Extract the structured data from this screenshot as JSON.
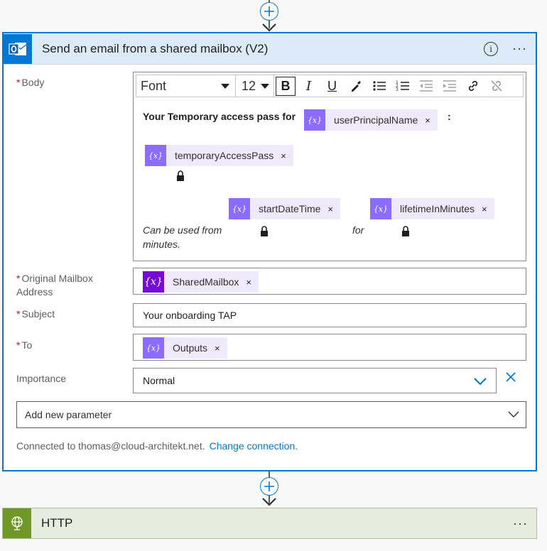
{
  "colors": {
    "accent": "#0078d4",
    "token": "#8c6cff",
    "http": "#709727"
  },
  "card": {
    "title": "Send an email from a shared mailbox (V2)",
    "info_icon": "info-icon",
    "more_label": "···"
  },
  "fields": {
    "body_label": "Body",
    "mailbox_label_1": "Original Mailbox",
    "mailbox_label_2": "Address",
    "subject_label": "Subject",
    "to_label": "To",
    "importance_label": "Importance",
    "required_mark": "*"
  },
  "toolbar": {
    "font": "Font",
    "size": "12",
    "bold": "B",
    "italic": "I",
    "underline": "U"
  },
  "body": {
    "intro": "Your Temporary access pass for",
    "colon": ":",
    "token_upn": "userPrincipalName",
    "token_tap": "temporaryAccessPass",
    "usable_from": "Can be used from",
    "token_start": "startDateTime",
    "for_text": "for",
    "token_lifetime": "lifetimeInMinutes",
    "minutes": "minutes."
  },
  "values": {
    "mailbox_token": "SharedMailbox",
    "subject": "Your onboarding TAP",
    "to_token": "Outputs",
    "importance": "Normal",
    "token_remove": "×"
  },
  "add_param": {
    "label": "Add new parameter"
  },
  "connection": {
    "text": "Connected to thomas@cloud-architekt.net.",
    "link": "Change connection."
  },
  "http_card": {
    "title": "HTTP",
    "more_label": "···"
  }
}
